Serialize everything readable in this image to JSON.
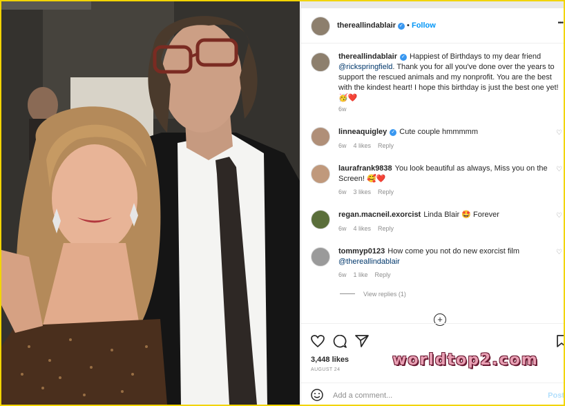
{
  "post": {
    "username": "thereallindablair",
    "follow_label": "Follow",
    "more_label": "•••"
  },
  "caption": {
    "username": "thereallindablair",
    "text_before": "Happiest of Birthdays to my dear friend",
    "mention": "@rickspringfield",
    "text_after": ". Thank you for all you've done over the years to support the rescued animals and my nonprofit. You are the best with the kindest heart! I hope this birthday is just the best one yet! 🥳❤️",
    "time": "6w"
  },
  "comments": [
    {
      "username": "linneaquigley",
      "verified": true,
      "text": "Cute couple hmmmmm",
      "time": "6w",
      "likes": "4 likes",
      "reply": "Reply"
    },
    {
      "username": "laurafrank9838",
      "verified": false,
      "text": "You look beautiful as always, Miss you on the Screen! 🥰❤️",
      "time": "6w",
      "likes": "3 likes",
      "reply": "Reply"
    },
    {
      "username": "regan.macneil.exorcist",
      "verified": false,
      "text": "Linda Blair 🤩 Forever",
      "time": "6w",
      "likes": "4 likes",
      "reply": "Reply"
    },
    {
      "username": "tommyp0123",
      "verified": false,
      "text": "How come you not do new exorcist film",
      "mention": "@thereallindablair",
      "time": "6w",
      "likes": "1 like",
      "reply": "Reply"
    }
  ],
  "view_replies": "View replies (1)",
  "likes_count": "3,448 likes",
  "post_date": "AUGUST 24",
  "add_comment_placeholder": "Add a comment...",
  "post_button": "Post",
  "watermark": "worldtop2.com",
  "colors": {
    "accent": "#3897f0",
    "frame": "#f2d400",
    "link": "#00376b"
  },
  "icons": [
    "heart-icon",
    "comment-icon",
    "share-icon",
    "bookmark-icon",
    "emoji-icon",
    "add-circle-icon",
    "verified-icon"
  ]
}
